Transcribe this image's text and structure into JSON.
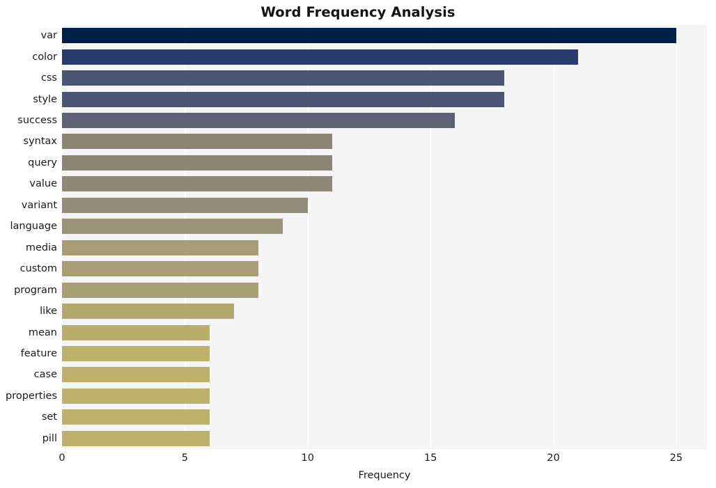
{
  "chart_data": {
    "type": "bar",
    "orientation": "horizontal",
    "title": "Word Frequency Analysis",
    "xlabel": "Frequency",
    "ylabel": "",
    "xlim": [
      0,
      26.25
    ],
    "xticks": [
      0,
      5,
      10,
      15,
      20,
      25
    ],
    "xticklabels": [
      "0",
      "5",
      "10",
      "15",
      "20",
      "25"
    ],
    "grid": true,
    "grid_axis": "x",
    "grid_color": "#ffffff",
    "axes_facecolor": "#f5f5f6",
    "figure_facecolor": "#ffffff",
    "legend": null,
    "categories": [
      "var",
      "color",
      "css",
      "style",
      "success",
      "syntax",
      "query",
      "value",
      "variant",
      "language",
      "media",
      "custom",
      "program",
      "like",
      "mean",
      "feature",
      "case",
      "properties",
      "set",
      "pill"
    ],
    "values": [
      25,
      21,
      18,
      18,
      16,
      11,
      11,
      11,
      10,
      9,
      8,
      8,
      8,
      7,
      6,
      6,
      6,
      6,
      6,
      6
    ],
    "colors": [
      "#002147",
      "#2a3c6e",
      "#4b5473",
      "#4b5473",
      "#5c6272",
      "#8a8677",
      "#8a8676",
      "#8d8879",
      "#938d79",
      "#9a9379",
      "#a79e78",
      "#a89f78",
      "#a89f78",
      "#b2a86f",
      "#b8ad6c",
      "#bdb16c",
      "#bdb16c",
      "#bdb16c",
      "#bdb16c",
      "#bdb16c"
    ]
  }
}
